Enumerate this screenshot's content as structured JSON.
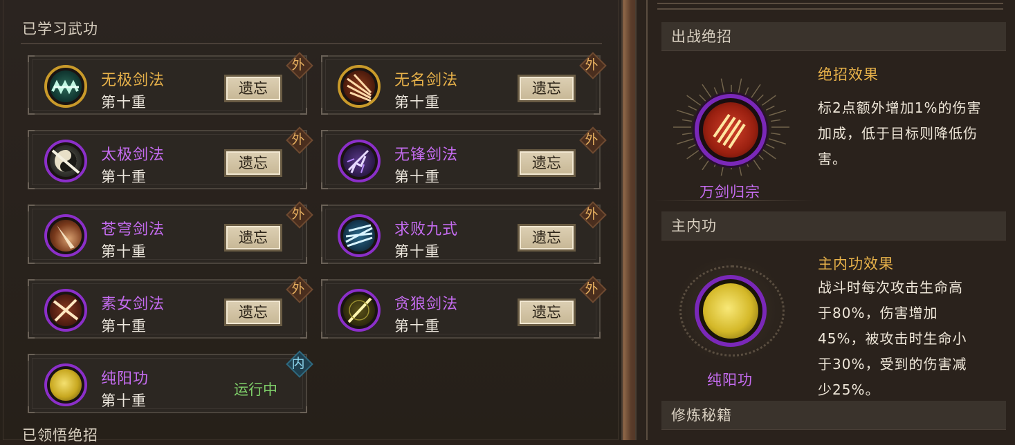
{
  "left": {
    "learned_title": "已学习武功",
    "realized_title": "已领悟绝招",
    "forget_label": "遗忘",
    "running_label": "运行中",
    "skills": [
      {
        "name": "无极剑法",
        "level": "第十重",
        "tag": "外",
        "name_color": "gold",
        "icon": "sword-wave-icon"
      },
      {
        "name": "无名剑法",
        "level": "第十重",
        "tag": "外",
        "name_color": "gold",
        "icon": "claw-strike-icon"
      },
      {
        "name": "太极剑法",
        "level": "第十重",
        "tag": "外",
        "name_color": "purple",
        "icon": "taiji-sword-icon"
      },
      {
        "name": "无锋剑法",
        "level": "第十重",
        "tag": "外",
        "name_color": "purple",
        "icon": "lightning-sword-icon"
      },
      {
        "name": "苍穹剑法",
        "level": "第十重",
        "tag": "外",
        "name_color": "purple",
        "icon": "sky-burst-icon"
      },
      {
        "name": "求败九式",
        "level": "第十重",
        "tag": "外",
        "name_color": "purple",
        "icon": "ice-slash-icon"
      },
      {
        "name": "素女剑法",
        "level": "第十重",
        "tag": "外",
        "name_color": "purple",
        "icon": "cross-sword-icon"
      },
      {
        "name": "贪狼剑法",
        "level": "第十重",
        "tag": "外",
        "name_color": "purple",
        "icon": "wolf-slash-icon"
      },
      {
        "name": "纯阳功",
        "level": "第十重",
        "tag": "内",
        "name_color": "purple",
        "icon": "sun-orb-icon"
      }
    ]
  },
  "right": {
    "battle_ult_header": "出战绝招",
    "ult_effect_title": "绝招效果",
    "ult_effect_text": [
      "标2点额外增加1%的伤害",
      "加成，低于目标则降低伤",
      "害。"
    ],
    "ult_name": "万剑归宗",
    "main_internal_header": "主内功",
    "main_internal_effect_title": "主内功效果",
    "main_internal_effect_text": [
      "战斗时每次攻击生命高",
      "于80%，伤害增加",
      "45%，被攻击时生命小",
      "于30%，受到的伤害减",
      "少25%。"
    ],
    "main_internal_name": "纯阳功",
    "cultivation_header": "修炼秘籍"
  },
  "colors": {
    "gold": "#e8b24a",
    "purple": "#c56cf0",
    "running_green": "#7fd06a"
  }
}
